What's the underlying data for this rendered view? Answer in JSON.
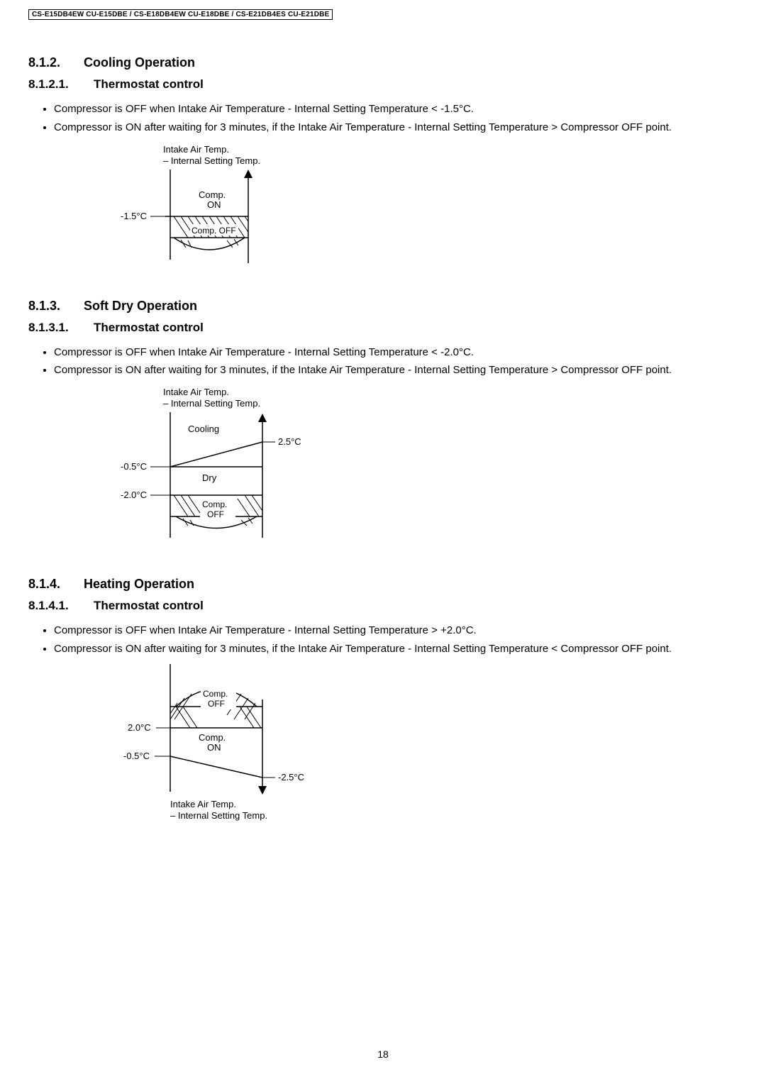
{
  "header": {
    "models": "CS-E15DB4EW CU-E15DBE / CS-E18DB4EW CU-E18DBE / CS-E21DB4ES CU-E21DBE"
  },
  "page_number": "18",
  "s812": {
    "num": "8.1.2.",
    "title": "Cooling Operation"
  },
  "s8121": {
    "num": "8.1.2.1.",
    "title": "Thermostat control",
    "bullet1": "Compressor is OFF when Intake Air Temperature - Internal Setting Temperature < -1.5°C.",
    "bullet2": "Compressor is ON after waiting for 3 minutes, if the Intake Air Temperature - Internal Setting Temperature > Compressor OFF point."
  },
  "diag1": {
    "line1": "Intake Air Temp.",
    "line2": "– Internal Setting Temp.",
    "compon": "Comp.",
    "compon2": "ON",
    "compoff": "Comp. OFF",
    "t1": "-1.5°C"
  },
  "s813": {
    "num": "8.1.3.",
    "title": "Soft Dry Operation"
  },
  "s8131": {
    "num": "8.1.3.1.",
    "title": "Thermostat control",
    "bullet1": "Compressor is OFF when Intake Air Temperature - Internal Setting Temperature < -2.0°C.",
    "bullet2": "Compressor is ON after waiting for 3 minutes, if the Intake Air Temperature - Internal Setting Temperature > Compressor OFF point."
  },
  "diag2": {
    "line1": "Intake Air Temp.",
    "line2": "– Internal Setting Temp.",
    "cooling": "Cooling",
    "dry": "Dry",
    "compoff1": "Comp.",
    "compoff2": "OFF",
    "t25": "2.5°C",
    "tn05": "-0.5°C",
    "tn20": "-2.0°C"
  },
  "s814": {
    "num": "8.1.4.",
    "title": "Heating Operation"
  },
  "s8141": {
    "num": "8.1.4.1.",
    "title": "Thermostat control",
    "bullet1": "Compressor is OFF when Intake Air Temperature - Internal Setting Temperature > +2.0°C.",
    "bullet2": "Compressor is ON after waiting for 3 minutes, if the Intake Air Temperature - Internal Setting Temperature < Compressor OFF point."
  },
  "diag3": {
    "compoff1": "Comp.",
    "compoff2": "OFF",
    "compon1": "Comp.",
    "compon2": "ON",
    "t20": "2.0°C",
    "tn05": "-0.5°C",
    "tn25": "-2.5°C",
    "line1": "Intake Air Temp.",
    "line2": "– Internal Setting Temp."
  }
}
